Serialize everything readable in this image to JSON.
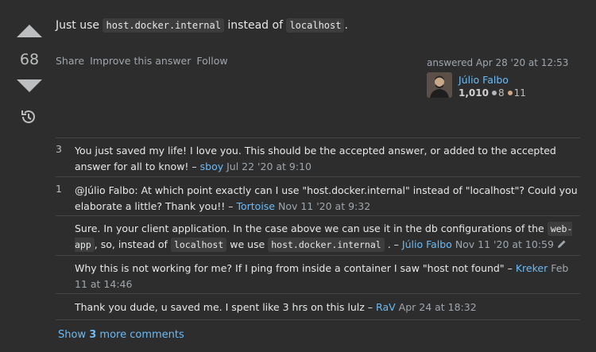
{
  "answer": {
    "score": "68",
    "body": {
      "prefix": "Just use",
      "code1": "host.docker.internal",
      "middle": "instead of",
      "code2": "localhost",
      "suffix": "."
    },
    "actions": [
      "Share",
      "Improve this answer",
      "Follow"
    ],
    "answered_label": "answered Apr 28 '20 at 12:53",
    "user": {
      "name": "Júlio Falbo",
      "reputation": "1,010",
      "silver": "8",
      "bronze": "11"
    }
  },
  "colors": {
    "link": "#6bbbf7",
    "silver": "#b4b8bc",
    "bronze": "#d1a684",
    "background": "#2d2d2d"
  },
  "comments": [
    {
      "score": "3",
      "text": "You just saved my life! I love you. This should be the accepted answer, or added to the accepted answer for all to know!",
      "user": "sboy",
      "date": "Jul 22 '20 at 9:10"
    },
    {
      "score": "1",
      "text": "@Júlio Falbo: At which point exactly can I use \"host.docker.internal\" instead of \"localhost\"? Could you elaborate a little? Thank you!!",
      "user": "Tortoise",
      "date": "Nov 11 '20 at 9:32"
    },
    {
      "score": "",
      "text_a": "Sure. In your client application. In the case above we can use it in the db configurations of the",
      "code_a": "web-app",
      "text_b": ", so, instead of",
      "code_b": "localhost",
      "text_c": "we use",
      "code_c": "host.docker.internal",
      "text_d": ".",
      "user": "Júlio Falbo",
      "date": "Nov 11 '20 at 10:59"
    },
    {
      "score": "",
      "text": "Why this is not working for me? If I ping from inside a container I saw \"host not found\"",
      "user": "Kreker",
      "date": "Feb 11 at 14:46"
    },
    {
      "score": "",
      "text": "Thank you dude, u saved me. I spent like 3 hrs on this lulz",
      "user": "RaV",
      "date": "Apr 24 at 18:32"
    }
  ],
  "show_more": {
    "prefix": "Show",
    "count": "3",
    "suffix": "more comments"
  },
  "icons": [
    "vote-up-icon",
    "vote-down-icon",
    "history-icon",
    "edit-pencil-icon",
    "silver-badge-icon",
    "bronze-badge-icon"
  ]
}
